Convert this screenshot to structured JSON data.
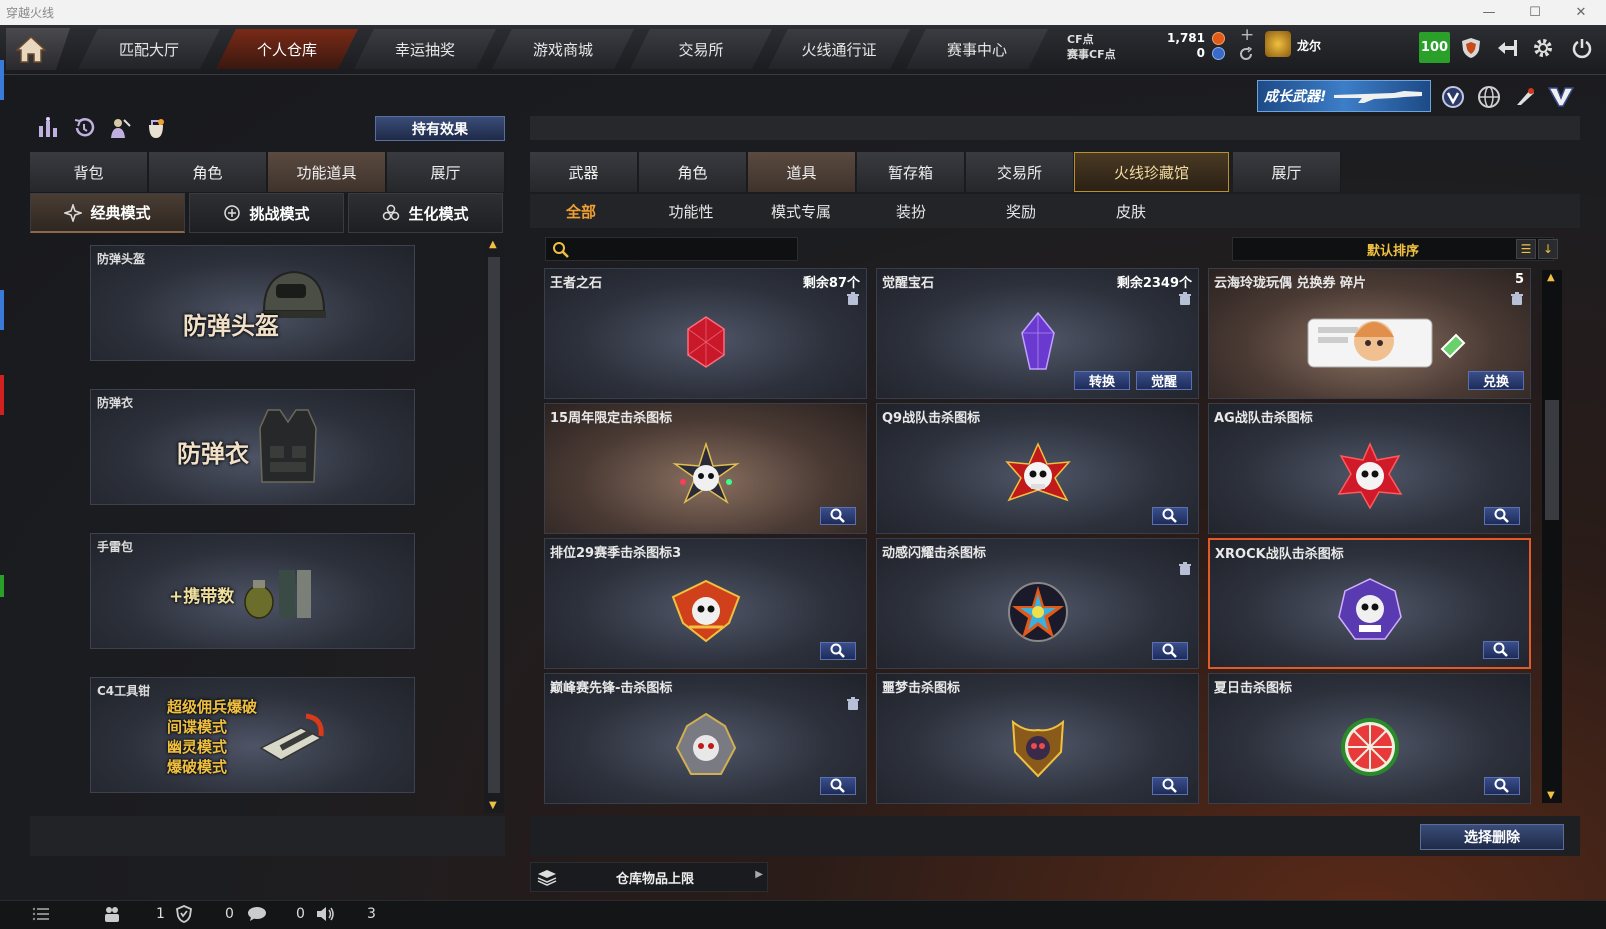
{
  "window": {
    "title": "穿越火线",
    "min": "—",
    "max": "☐",
    "close": "✕"
  },
  "nav": {
    "tabs": [
      "匹配大厅",
      "个人仓库",
      "幸运抽奖",
      "游戏商城",
      "交易所",
      "火线通行证",
      "赛事中心"
    ],
    "active_index": 1
  },
  "currency": {
    "cf_label": "CF点",
    "cf_value": "1,781",
    "match_label": "赛事CF点",
    "match_value": "0",
    "plus": "+"
  },
  "user": {
    "name": "龙尔",
    "level": "100"
  },
  "banner_text": "成长武器!",
  "left": {
    "hold_effect": "持有效果",
    "tabs": [
      "背包",
      "角色",
      "功能道具",
      "展厅"
    ],
    "active_tab": 2,
    "modes": [
      "经典模式",
      "挑战模式",
      "生化模式"
    ],
    "active_mode": 0,
    "items": [
      {
        "name": "防弹头盔",
        "big": "防弹头盔"
      },
      {
        "name": "防弹衣",
        "big": "防弹衣"
      },
      {
        "name": "手雷包",
        "big": "+携带数"
      },
      {
        "name": "C4工具钳",
        "lines": [
          "超级佣兵爆破",
          "间谍模式",
          "幽灵模式",
          "爆破模式"
        ]
      }
    ]
  },
  "right": {
    "tabs": [
      "武器",
      "角色",
      "道具",
      "暂存箱",
      "交易所",
      "火线珍藏馆",
      "展厅"
    ],
    "active_tab": 2,
    "gold_tab": 5,
    "subtabs": [
      "全部",
      "功能性",
      "模式专属",
      "装扮",
      "奖励",
      "皮肤"
    ],
    "active_subtab": 0,
    "search_placeholder": "",
    "sort_label": "默认排序",
    "cards": [
      {
        "name": "王者之石",
        "count": "剩余87个",
        "trash": true,
        "art": "red-gem"
      },
      {
        "name": "觉醒宝石",
        "count": "剩余2349个",
        "trash": true,
        "art": "purple-gem",
        "buttons": [
          "转换",
          "觉醒"
        ]
      },
      {
        "name": "云海玲珑玩偶 兑换券 碎片",
        "count": "5",
        "trash": true,
        "art": "ticket",
        "buttons": [
          "兑换"
        ],
        "warm": true
      },
      {
        "name": "15周年限定击杀图标",
        "art": "skull-star",
        "mag": true,
        "warm": true
      },
      {
        "name": "Q9战队击杀图标",
        "art": "skull-red",
        "mag": true
      },
      {
        "name": "AG战队击杀图标",
        "art": "skull-red2",
        "mag": true
      },
      {
        "name": "排位29赛季击杀图标3",
        "art": "skull-wing",
        "mag": true
      },
      {
        "name": "动感闪耀击杀图标",
        "art": "star-rainbow",
        "mag": true,
        "trash": true
      },
      {
        "name": "XROCK战队击杀图标",
        "art": "skull-purple",
        "mag": true,
        "selected": true
      },
      {
        "name": "巅峰赛先锋-击杀图标",
        "art": "skull-helm",
        "mag": true,
        "trash": true
      },
      {
        "name": "噩梦击杀图标",
        "art": "skull-gold",
        "mag": true
      },
      {
        "name": "夏日击杀图标",
        "art": "watermelon",
        "mag": true
      }
    ],
    "select_delete": "选择删除",
    "capacity_label": "仓库物品上限"
  },
  "status": {
    "friends": "1",
    "clan": "0",
    "messages": "0",
    "volume": "3"
  }
}
